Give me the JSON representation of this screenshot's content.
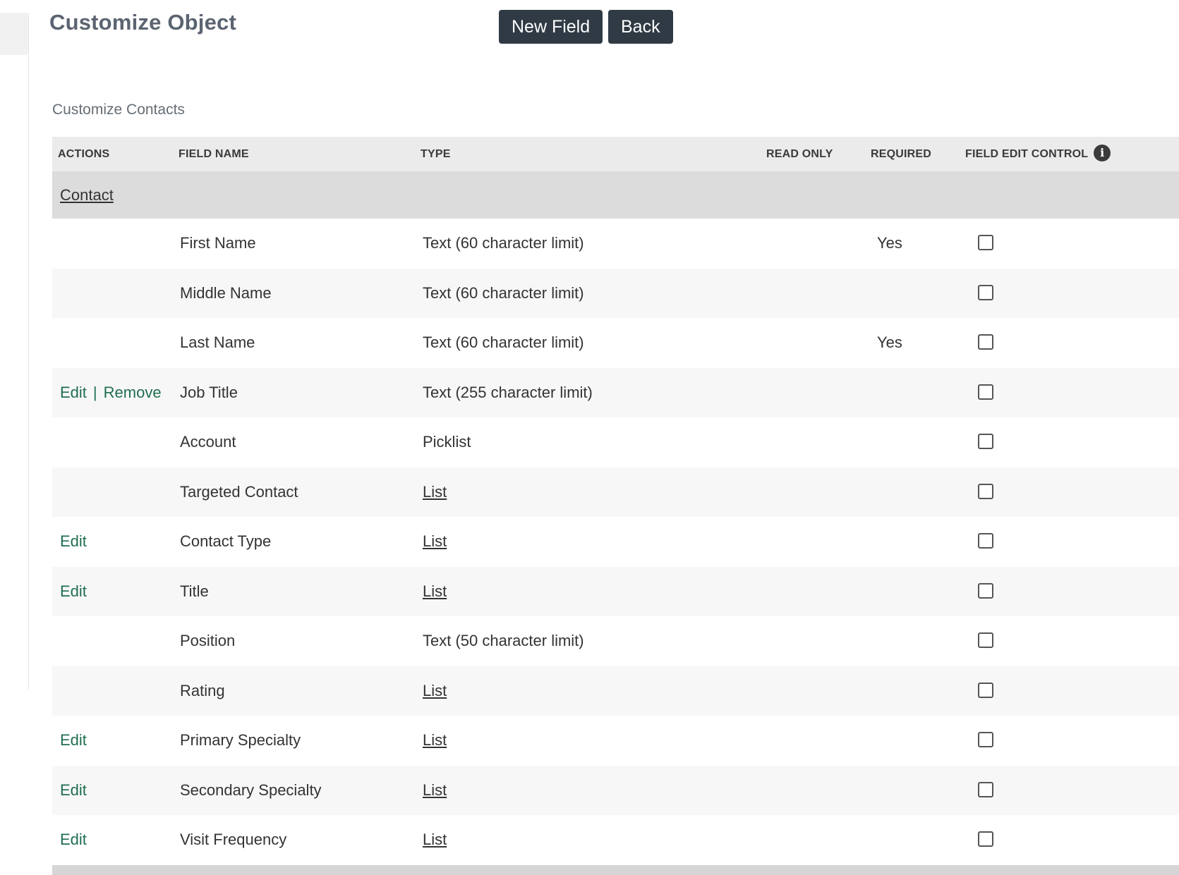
{
  "header": {
    "title": "Customize Object",
    "new_field_label": "New Field",
    "back_label": "Back"
  },
  "section_title": "Customize Contacts",
  "table": {
    "columns": {
      "actions": "ACTIONS",
      "field_name": "FIELD NAME",
      "type": "TYPE",
      "read_only": "READ ONLY",
      "required": "REQUIRED",
      "field_edit_control": "FIELD EDIT CONTROL"
    },
    "info_icon_glyph": "i",
    "group": "Contact",
    "rows": [
      {
        "edit": "",
        "sep": "",
        "remove": "",
        "name": "First Name",
        "type": "Text (60 character limit)",
        "type_is_link": false,
        "required": "Yes"
      },
      {
        "edit": "",
        "sep": "",
        "remove": "",
        "name": "Middle Name",
        "type": "Text (60 character limit)",
        "type_is_link": false,
        "required": ""
      },
      {
        "edit": "",
        "sep": "",
        "remove": "",
        "name": "Last Name",
        "type": "Text (60 character limit)",
        "type_is_link": false,
        "required": "Yes"
      },
      {
        "edit": "Edit",
        "sep": "|",
        "remove": "Remove",
        "name": "Job Title",
        "type": "Text (255 character limit)",
        "type_is_link": false,
        "required": ""
      },
      {
        "edit": "",
        "sep": "",
        "remove": "",
        "name": "Account",
        "type": "Picklist",
        "type_is_link": false,
        "required": ""
      },
      {
        "edit": "",
        "sep": "",
        "remove": "",
        "name": "Targeted Contact",
        "type": "List",
        "type_is_link": true,
        "required": ""
      },
      {
        "edit": "Edit",
        "sep": "",
        "remove": "",
        "name": "Contact Type",
        "type": "List",
        "type_is_link": true,
        "required": ""
      },
      {
        "edit": "Edit",
        "sep": "",
        "remove": "",
        "name": "Title",
        "type": "List",
        "type_is_link": true,
        "required": ""
      },
      {
        "edit": "",
        "sep": "",
        "remove": "",
        "name": "Position",
        "type": "Text (50 character limit)",
        "type_is_link": false,
        "required": ""
      },
      {
        "edit": "",
        "sep": "",
        "remove": "",
        "name": "Rating",
        "type": "List",
        "type_is_link": true,
        "required": ""
      },
      {
        "edit": "Edit",
        "sep": "",
        "remove": "",
        "name": "Primary Specialty",
        "type": "List",
        "type_is_link": true,
        "required": ""
      },
      {
        "edit": "Edit",
        "sep": "",
        "remove": "",
        "name": "Secondary Specialty",
        "type": "List",
        "type_is_link": true,
        "required": ""
      },
      {
        "edit": "Edit",
        "sep": "",
        "remove": "",
        "name": "Visit Frequency",
        "type": "List",
        "type_is_link": true,
        "required": ""
      }
    ]
  },
  "colors": {
    "button_bg": "#2f3a44",
    "action_link": "#1f6e4f",
    "header_bg": "#ebebeb",
    "group_bg": "#dcdcdc",
    "stripe_bg": "#f7f7f7"
  },
  "icons": {
    "info": "info-icon",
    "checkbox": "checkbox-icon"
  }
}
